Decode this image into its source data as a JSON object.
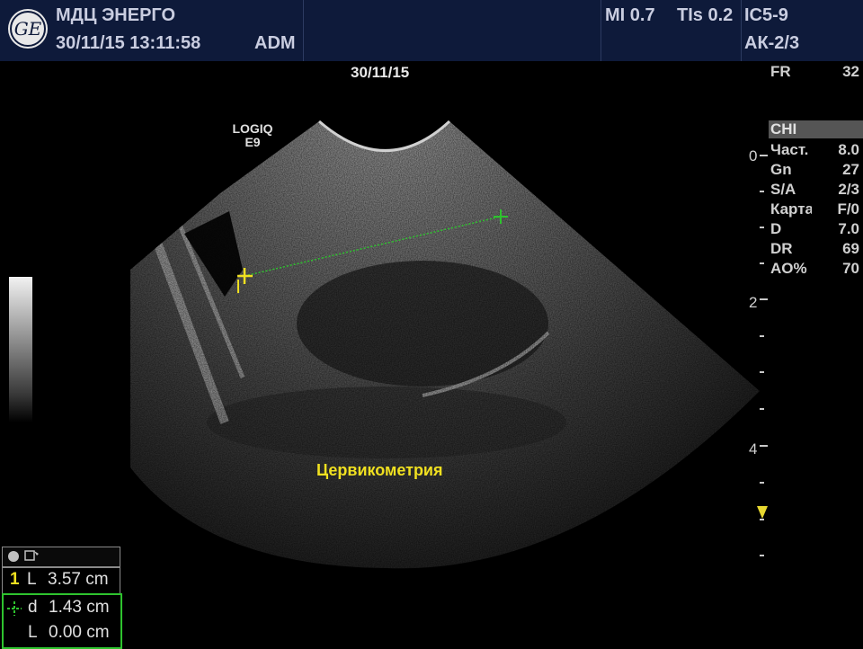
{
  "header": {
    "clinic": "МДЦ ЭНЕРГО",
    "datetime": "30/11/15 13:11:58",
    "operator": "ADM",
    "mi": "MI 0.7",
    "tis": "TIs 0.2",
    "probe": "IC5-9",
    "preset": "АК-2/3"
  },
  "image": {
    "date": "30/11/15",
    "system_line1": "LOGIQ",
    "system_line2": "E9",
    "annotation": "Цервикометрия"
  },
  "params": {
    "fr_label": "FR",
    "fr_value": "32",
    "mode": "CHI",
    "rows": [
      {
        "label": "Част.",
        "value": "8.0"
      },
      {
        "label": "Gn",
        "value": "27"
      },
      {
        "label": "S/A",
        "value": "2/3"
      },
      {
        "label": "Карта",
        "value": "F/0"
      },
      {
        "label": "D",
        "value": "7.0"
      },
      {
        "label": "DR",
        "value": "69"
      },
      {
        "label": "AO%",
        "value": "70"
      }
    ]
  },
  "depth_scale": {
    "labels": [
      "0",
      "2",
      "4"
    ]
  },
  "measurements": {
    "row1_index": "1",
    "row1_label": "L",
    "row1_value": "3.57 cm",
    "row2_label": "d",
    "row2_value": "1.43 cm",
    "row3_label": "L",
    "row3_value": "0.00 cm"
  },
  "colors": {
    "header_bg": "#0e1a3a",
    "caliper1": "#f0e020",
    "caliper2": "#2ec32e",
    "annotation": "#f0e020"
  }
}
